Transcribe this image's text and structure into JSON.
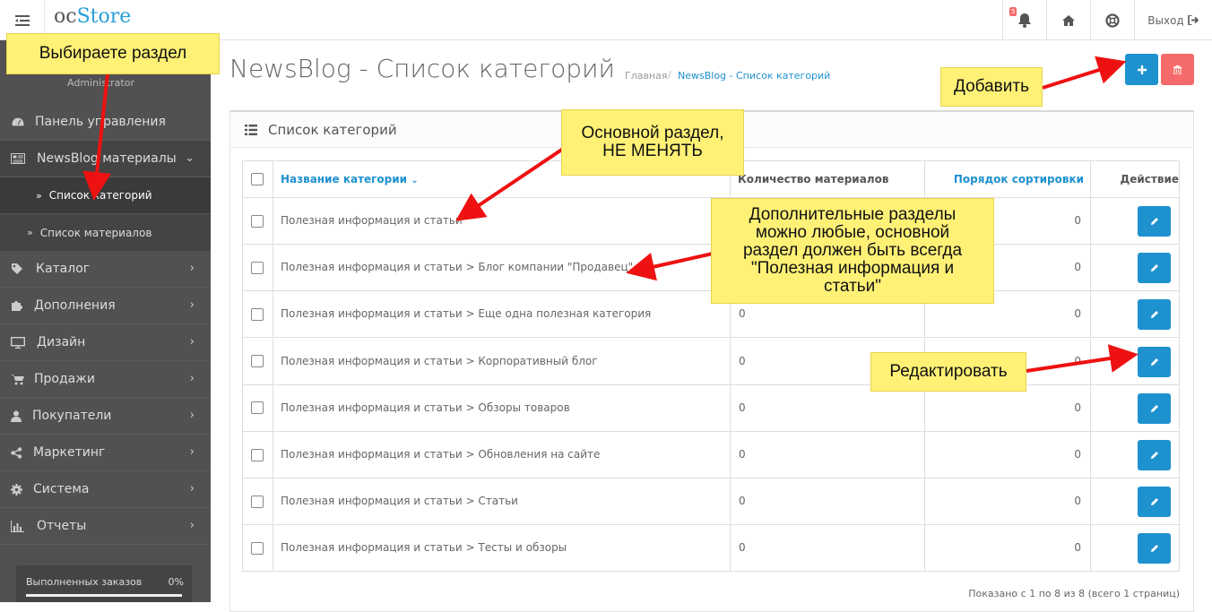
{
  "header": {
    "logo_oc": "oc",
    "logo_store": "Store",
    "notification_count": "5",
    "logout_label": "Выход"
  },
  "sidebar": {
    "profile_role": "Administrator",
    "items": [
      {
        "label": "Панель управления",
        "icon": "dashboard-icon"
      },
      {
        "label": "NewsBlog материалы",
        "icon": "newspaper-icon"
      },
      {
        "label": "Каталог",
        "icon": "tag-icon"
      },
      {
        "label": "Дополнения",
        "icon": "puzzle-icon"
      },
      {
        "label": "Дизайн",
        "icon": "monitor-icon"
      },
      {
        "label": "Продажи",
        "icon": "cart-icon"
      },
      {
        "label": "Покупатели",
        "icon": "user-icon"
      },
      {
        "label": "Маркетинг",
        "icon": "share-icon"
      },
      {
        "label": "Система",
        "icon": "gear-icon"
      },
      {
        "label": "Отчеты",
        "icon": "bar-chart-icon"
      }
    ],
    "sub_items": [
      {
        "label": "Список категорий",
        "active": true
      },
      {
        "label": "Список материалов",
        "active": false
      }
    ],
    "progress": {
      "label": "Выполненных заказов",
      "value": "0%"
    }
  },
  "page": {
    "title": "NewsBlog - Список категорий",
    "breadcrumb": [
      "Главная",
      "NewsBlog - Список категорий"
    ],
    "breadcrumb_separator": "/"
  },
  "panel": {
    "title": "Список категорий"
  },
  "table": {
    "headers": {
      "name": "Название категории",
      "count": "Количество материалов",
      "sort": "Порядок сортировки",
      "action": "Действие"
    },
    "rows": [
      {
        "name": "Полезная информация и статьи",
        "count": "",
        "sort": "0"
      },
      {
        "name": "Полезная информация и статьи  >  Блог компании \"Продавец\"",
        "count": "",
        "sort": "0"
      },
      {
        "name": "Полезная информация и статьи  >  Еще одна полезная категория",
        "count": "0",
        "sort": "0"
      },
      {
        "name": "Полезная информация и статьи  >  Корпоративный блог",
        "count": "0",
        "sort": "0"
      },
      {
        "name": "Полезная информация и статьи  >  Обзоры товаров",
        "count": "0",
        "sort": "0"
      },
      {
        "name": "Полезная информация и статьи  >  Обновления на сайте",
        "count": "0",
        "sort": "0"
      },
      {
        "name": "Полезная информация и статьи  >  Статьи",
        "count": "0",
        "sort": "0"
      },
      {
        "name": "Полезная информация и статьи  >  Тесты и обзоры",
        "count": "0",
        "sort": "0"
      }
    ],
    "pagination_info": "Показано с 1 по 8 из 8 (всего 1 страниц)"
  },
  "annotations": {
    "choose_section": "Выбираете раздел",
    "main_section": "Основной раздел,\nНЕ МЕНЯТЬ",
    "extra_sections": "Дополнительные разделы\nможно любые, основной\nраздел должен быть всегда\n\"Полезная информация и\nстатьи\"",
    "add": "Добавить",
    "edit": "Редактировать"
  },
  "colors": {
    "primary": "#1e91cf",
    "danger": "#f56b6b",
    "sidebar": "#515151",
    "note": "#fff176",
    "arrow": "#ee1111"
  }
}
